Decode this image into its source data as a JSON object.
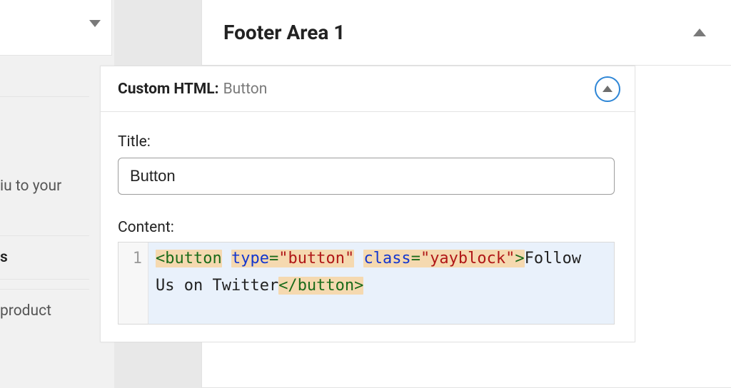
{
  "sidebar": {
    "frag1": "iu to your",
    "frag2": "s",
    "frag3": "product"
  },
  "section": {
    "title": "Footer Area 1"
  },
  "widget": {
    "type_label": "Custom HTML:",
    "name": "Button",
    "title_label": "Title:",
    "title_value": "Button",
    "content_label": "Content:",
    "code": {
      "line_number": "1",
      "open_lt": "<",
      "tag": "button",
      "attr_type": "type",
      "eq": "=",
      "q": "\"",
      "val_type": "button",
      "attr_class": "class",
      "val_class": "yayblock",
      "gt": ">",
      "inner_text": "Follow Us on Twitter",
      "close_open": "</",
      "close_tag": "button",
      "close_gt": ">"
    }
  }
}
